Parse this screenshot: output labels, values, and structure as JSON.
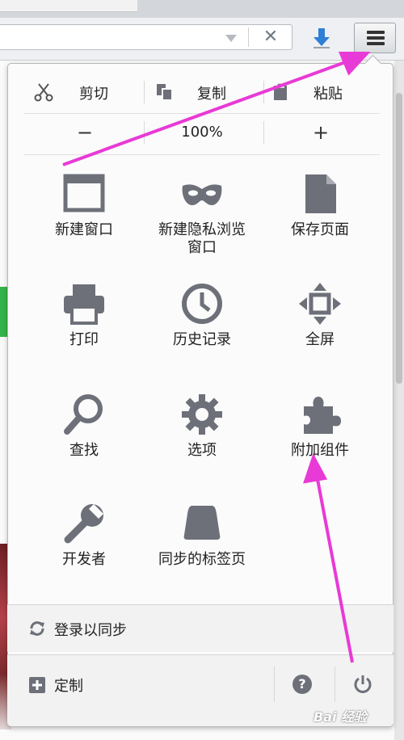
{
  "toolbar": {
    "clear_symbol": "✕"
  },
  "menu": {
    "edit": {
      "cut": "剪切",
      "copy": "复制",
      "paste": "粘贴"
    },
    "zoom": {
      "minus": "−",
      "level": "100%",
      "plus": "+"
    },
    "items": [
      {
        "icon": "new-window-icon",
        "label": "新建窗口"
      },
      {
        "icon": "private-mask-icon",
        "label": "新建隐私浏览\n窗口"
      },
      {
        "icon": "save-page-icon",
        "label": "保存页面"
      },
      {
        "icon": "printer-icon",
        "label": "打印"
      },
      {
        "icon": "history-clock-icon",
        "label": "历史记录"
      },
      {
        "icon": "fullscreen-icon",
        "label": "全屏"
      },
      {
        "icon": "magnifier-icon",
        "label": "查找"
      },
      {
        "icon": "gear-icon",
        "label": "选项"
      },
      {
        "icon": "puzzle-icon",
        "label": "附加组件"
      },
      {
        "icon": "wrench-icon",
        "label": "开发者"
      },
      {
        "icon": "synced-tabs-icon",
        "label": "同步的标签页"
      }
    ],
    "sync_label": "登录以同步",
    "customize_label": "定制",
    "help_symbol": "?"
  },
  "watermark": "Bai 经验",
  "colors": {
    "accent_arrow": "#e83ad6",
    "icon_gray": "#6d7079",
    "download_blue": "#2f7fd6"
  }
}
